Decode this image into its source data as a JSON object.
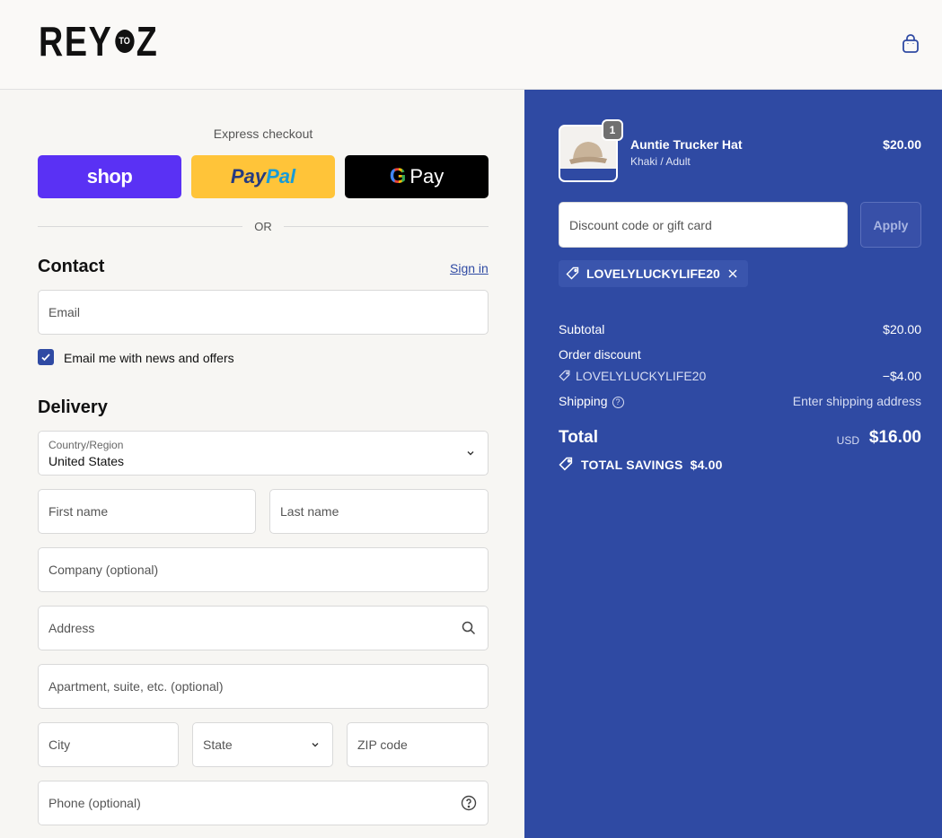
{
  "header": {
    "logo_left": "REY",
    "logo_circle": "TO",
    "logo_right": "Z",
    "cart_icon": "shopping-bag-icon"
  },
  "express": {
    "title": "Express checkout",
    "shop_label": "shop",
    "paypal_label_1": "Pay",
    "paypal_label_2": "Pal",
    "gpay_g": "G",
    "gpay_label": "Pay",
    "or_label": "OR"
  },
  "contact": {
    "title": "Contact",
    "signin_label": "Sign in",
    "email_placeholder": "Email",
    "newsletter_label": "Email me with news and offers",
    "newsletter_checked": true
  },
  "delivery": {
    "title": "Delivery",
    "country_label": "Country/Region",
    "country_value": "United States",
    "first_name": "First name",
    "last_name": "Last name",
    "company": "Company (optional)",
    "address": "Address",
    "apartment": "Apartment, suite, etc. (optional)",
    "city": "City",
    "state": "State",
    "zip": "ZIP code",
    "phone": "Phone (optional)"
  },
  "summary": {
    "product": {
      "name": "Auntie Trucker Hat",
      "variant": "Khaki / Adult",
      "price": "$20.00",
      "quantity": "1"
    },
    "discount_placeholder": "Discount code or gift card",
    "apply_label": "Apply",
    "applied_code": "LOVELYLUCKYLIFE20",
    "subtotal_label": "Subtotal",
    "subtotal_value": "$20.00",
    "order_discount_label": "Order discount",
    "discount_code": "LOVELYLUCKYLIFE20",
    "discount_value": "−$4.00",
    "shipping_label": "Shipping",
    "shipping_value": "Enter shipping address",
    "total_label": "Total",
    "currency": "USD",
    "total_value": "$16.00",
    "savings_label": "TOTAL SAVINGS",
    "savings_value": "$4.00"
  },
  "colors": {
    "accent": "#2f4aa3",
    "shop": "#5a31f4",
    "paypal": "#ffc439"
  }
}
